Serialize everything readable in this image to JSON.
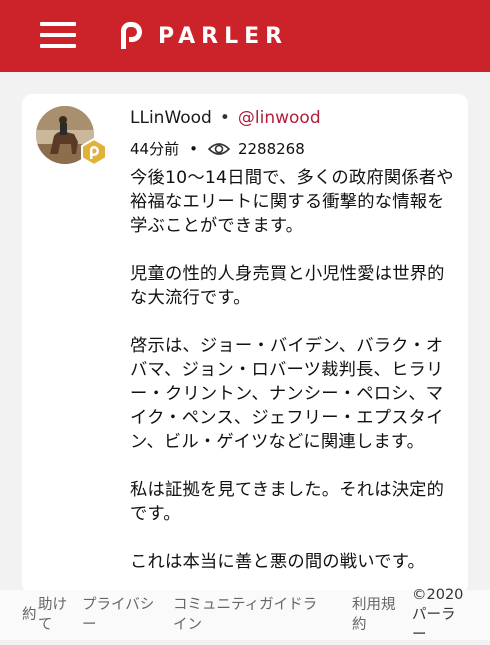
{
  "header": {
    "brand_name": "PARLER",
    "menu_icon": "hamburger-menu-icon",
    "logo_icon": "parler-logo-icon",
    "background_color": "#cc2229"
  },
  "post": {
    "author_name": "LLinWood",
    "separator": "•",
    "handle": "@linwood",
    "time_ago": "44分前",
    "meta_separator": "•",
    "views_icon": "eye-icon",
    "views": "2288268",
    "badge_icon": "verified-parler-badge-icon",
    "paragraphs": [
      "今後10～14日間で、多くの政府関係者や裕福なエリートに関する衝撃的な情報を学ぶことができます。",
      "児童の性的人身売買と小児性愛は世界的な大流行です。",
      "啓示は、ジョー・バイデン、バラク・オバマ、ジョン・ロバーツ裁判長、ヒラリー・クリントン、ナンシー・ペロシ、マイク・ペンス、ジェフリー・エプスタイン、ビル・ゲイツなどに関連します。",
      "私は証拠を見てきました。それは決定的です。",
      "これは本当に善と悪の間の戦いです。"
    ]
  },
  "footer": {
    "help_line1": "助け",
    "help_line2": "て",
    "terms_fragment": "約",
    "privacy_line1": "プライバシ",
    "privacy_line2": "ー",
    "guidelines_line1": "コミュニティガイドラ",
    "guidelines_line2": "イン",
    "terms_line1": "利用規",
    "terms_line2": "約",
    "copyright_line1": "©2020",
    "copyright_line2": "パーラ",
    "copyright_line3": "ー"
  }
}
